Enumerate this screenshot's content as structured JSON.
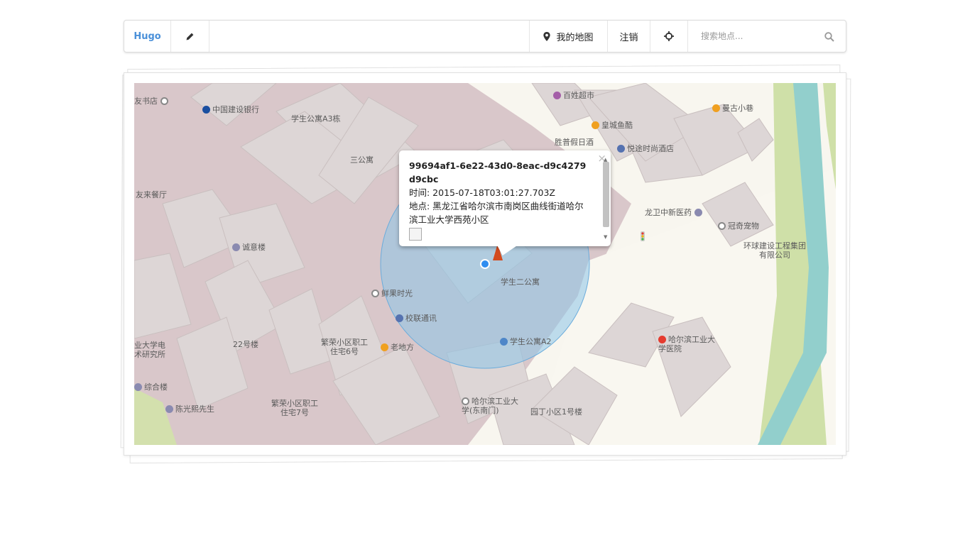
{
  "navbar": {
    "brand": "Hugo",
    "my_map_label": "我的地图",
    "logout_label": "注销",
    "search_placeholder": "搜索地点..."
  },
  "icons": {
    "edit": "pencil-icon",
    "my_map": "map-marker-icon",
    "locate": "crosshairs-icon",
    "search": "search-icon"
  },
  "map": {
    "labels": [
      "友书店",
      "中国建设银行",
      "学生公寓A3栋",
      "三公寓",
      "百姓超市",
      "皇城鱼酷",
      "曼古小巷",
      "胜普假日酒",
      "悦途时尚酒店",
      "友来餐厅",
      "龙卫中新医药",
      "冠奇宠物",
      "环球建设工程集团有限公司",
      "诚意楼",
      "鲜果时光",
      "学生二公寓",
      "校联通讯",
      "繁荣小区职工住宅6号",
      "老地方",
      "学生公寓A2",
      "22号楼",
      "业大学电术研究所",
      "哈尔滨工业大学医院",
      "综合楼",
      "陈光熙先生",
      "繁荣小区职工住宅7号",
      "哈尔滨工业大学(东南门)",
      "园丁小区1号楼"
    ],
    "colors": {
      "campus": "#d9c7ca",
      "building": "#ddd6d6",
      "road": "#f8f6ef",
      "green": "#cfe0a8",
      "river": "#92cfcc",
      "accuracy_circle": "#8cc4e8",
      "location_dot": "#2f8df0"
    }
  },
  "popup": {
    "id": "99694af1-6e22-43d0-8eac-d9c4279d9cbc",
    "time": "时间: 2015-07-18T03:01:27.703Z",
    "place": "地点: 黑龙江省哈尔滨市南岗区曲线街道哈尔滨工业大学西苑小区",
    "close": "×"
  }
}
